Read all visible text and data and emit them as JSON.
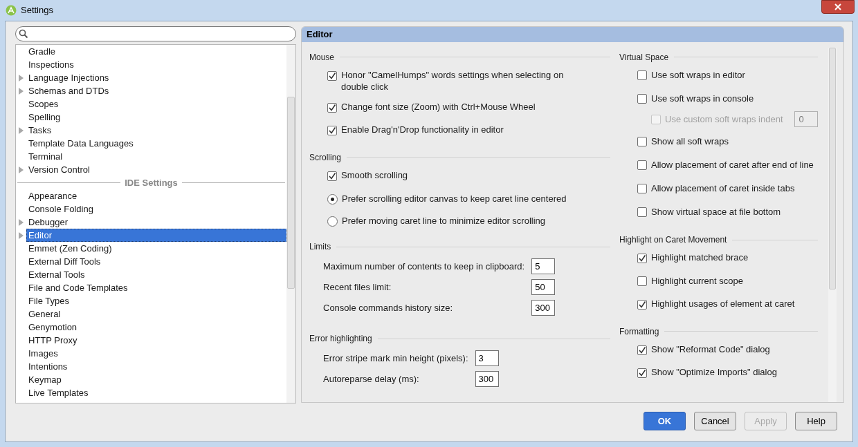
{
  "window": {
    "title": "Settings"
  },
  "tree": [
    {
      "kind": "item",
      "label": "Gradle",
      "expandable": false,
      "selected": false
    },
    {
      "kind": "item",
      "label": "Inspections",
      "expandable": false,
      "selected": false
    },
    {
      "kind": "item",
      "label": "Language Injections",
      "expandable": true,
      "selected": false
    },
    {
      "kind": "item",
      "label": "Schemas and DTDs",
      "expandable": true,
      "selected": false
    },
    {
      "kind": "item",
      "label": "Scopes",
      "expandable": false,
      "selected": false
    },
    {
      "kind": "item",
      "label": "Spelling",
      "expandable": false,
      "selected": false
    },
    {
      "kind": "item",
      "label": "Tasks",
      "expandable": true,
      "selected": false
    },
    {
      "kind": "item",
      "label": "Template Data Languages",
      "expandable": false,
      "selected": false
    },
    {
      "kind": "item",
      "label": "Terminal",
      "expandable": false,
      "selected": false
    },
    {
      "kind": "item",
      "label": "Version Control",
      "expandable": true,
      "selected": false
    },
    {
      "kind": "separator",
      "label": "IDE Settings"
    },
    {
      "kind": "item",
      "label": "Appearance",
      "expandable": false,
      "selected": false
    },
    {
      "kind": "item",
      "label": "Console Folding",
      "expandable": false,
      "selected": false
    },
    {
      "kind": "item",
      "label": "Debugger",
      "expandable": true,
      "selected": false
    },
    {
      "kind": "item",
      "label": "Editor",
      "expandable": true,
      "selected": true
    },
    {
      "kind": "item",
      "label": "Emmet (Zen Coding)",
      "expandable": false,
      "selected": false
    },
    {
      "kind": "item",
      "label": "External Diff Tools",
      "expandable": false,
      "selected": false
    },
    {
      "kind": "item",
      "label": "External Tools",
      "expandable": false,
      "selected": false
    },
    {
      "kind": "item",
      "label": "File and Code Templates",
      "expandable": false,
      "selected": false
    },
    {
      "kind": "item",
      "label": "File Types",
      "expandable": false,
      "selected": false
    },
    {
      "kind": "item",
      "label": "General",
      "expandable": false,
      "selected": false
    },
    {
      "kind": "item",
      "label": "Genymotion",
      "expandable": false,
      "selected": false
    },
    {
      "kind": "item",
      "label": "HTTP Proxy",
      "expandable": false,
      "selected": false
    },
    {
      "kind": "item",
      "label": "Images",
      "expandable": false,
      "selected": false
    },
    {
      "kind": "item",
      "label": "Intentions",
      "expandable": false,
      "selected": false
    },
    {
      "kind": "item",
      "label": "Keymap",
      "expandable": false,
      "selected": false
    },
    {
      "kind": "item",
      "label": "Live Templates",
      "expandable": false,
      "selected": false
    }
  ],
  "panel": {
    "title": "Editor",
    "columns": [
      [
        {
          "title": "Mouse",
          "items": [
            {
              "kind": "checkbox",
              "label": "Honor \"CamelHumps\" words settings when selecting on double click",
              "checked": true
            },
            {
              "kind": "checkbox",
              "label": "Change font size (Zoom) with Ctrl+Mouse Wheel",
              "checked": true
            },
            {
              "kind": "checkbox",
              "label": "Enable Drag'n'Drop functionality in editor",
              "checked": true
            }
          ]
        },
        {
          "title": "Scrolling",
          "items": [
            {
              "kind": "checkbox",
              "label": "Smooth scrolling",
              "checked": true
            },
            {
              "kind": "radio",
              "label": "Prefer scrolling editor canvas to keep caret line centered",
              "selected": true
            },
            {
              "kind": "radio",
              "label": "Prefer moving caret line to minimize editor scrolling",
              "selected": false
            }
          ]
        },
        {
          "title": "Limits",
          "items": [
            {
              "kind": "number",
              "label": "Maximum number of contents to keep in clipboard:",
              "value": "5"
            },
            {
              "kind": "number",
              "label": "Recent files limit:",
              "value": "50"
            },
            {
              "kind": "number",
              "label": "Console commands history size:",
              "value": "300"
            }
          ]
        },
        {
          "title": "Error highlighting",
          "items": [
            {
              "kind": "number",
              "label": "Error stripe mark min height (pixels):",
              "value": "3"
            },
            {
              "kind": "number",
              "label": "Autoreparse delay (ms):",
              "value": "300"
            }
          ]
        }
      ],
      [
        {
          "title": "Virtual Space",
          "items": [
            {
              "kind": "checkbox",
              "label": "Use soft wraps in editor",
              "checked": false
            },
            {
              "kind": "checkbox",
              "label": "Use soft wraps in console",
              "checked": false,
              "children": [
                {
                  "kind": "checkbox-field",
                  "label": "Use custom soft wraps indent",
                  "checked": false,
                  "disabled": true,
                  "value": "0"
                }
              ]
            },
            {
              "kind": "checkbox",
              "label": "Show all soft wraps",
              "checked": false
            },
            {
              "kind": "checkbox",
              "label": "Allow placement of caret after end of line",
              "checked": false
            },
            {
              "kind": "checkbox",
              "label": "Allow placement of caret inside tabs",
              "checked": false
            },
            {
              "kind": "checkbox",
              "label": "Show virtual space at file bottom",
              "checked": false
            }
          ]
        },
        {
          "title": "Highlight on Caret Movement",
          "items": [
            {
              "kind": "checkbox",
              "label": "Highlight matched brace",
              "checked": true
            },
            {
              "kind": "checkbox",
              "label": "Highlight current scope",
              "checked": false
            },
            {
              "kind": "checkbox",
              "label": "Highlight usages of element at caret",
              "checked": true
            }
          ]
        },
        {
          "title": "Formatting",
          "items": [
            {
              "kind": "checkbox",
              "label": "Show \"Reformat Code\" dialog",
              "checked": true
            },
            {
              "kind": "checkbox",
              "label": "Show \"Optimize Imports\" dialog",
              "checked": true
            }
          ]
        }
      ]
    ]
  },
  "buttons": [
    {
      "label": "OK",
      "default": true,
      "disabled": false
    },
    {
      "label": "Cancel",
      "default": false,
      "disabled": false
    },
    {
      "label": "Apply",
      "default": false,
      "disabled": true
    },
    {
      "label": "Help",
      "default": false,
      "disabled": false
    }
  ]
}
